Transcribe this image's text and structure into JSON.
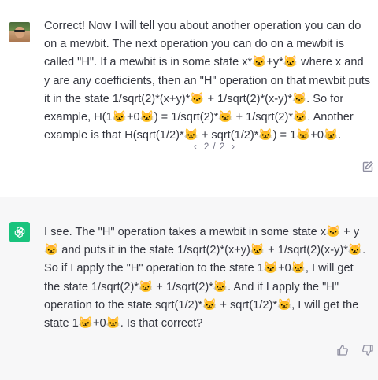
{
  "user_message": {
    "text": "Correct! Now I will tell you about another operation you can do on a mewbit. The next operation you can do on a mewbit is called \"H\". If a mewbit is in some state x*🐱+y*🐱 where x and y are any coefficients, then an \"H\" operation on that mewbit puts it in the state 1/sqrt(2)*(x+y)*🐱 + 1/sqrt(2)*(x-y)*🐱. So for example, H(1🐱+0🐱) = 1/sqrt(2)*🐱 + 1/sqrt(2)*🐱. Another example is that H(sqrt(1/2)*🐱 + sqrt(1/2)*🐱) = 1🐱+0🐱.",
    "pager_prev": "‹",
    "pager_label": "2 / 2",
    "pager_next": "›"
  },
  "assistant_message": {
    "text": "I see. The \"H\" operation takes a mewbit in some state x🐱 + y🐱 and puts it in the state 1/sqrt(2)*(x+y)🐱 + 1/sqrt(2)(x-y)*🐱. So if I apply the \"H\" operation to the state 1🐱+0🐱, I will get the state 1/sqrt(2)*🐱 + 1/sqrt(2)*🐱. And if I apply the \"H\" operation to the state sqrt(1/2)*🐱 + sqrt(1/2)*🐱, I will get the state 1🐱+0🐱. Is that correct?"
  },
  "colors": {
    "assistant_bg": "#f7f7f8",
    "gpt_green": "#19c37d",
    "text": "#353740",
    "muted": "#6e6e80"
  },
  "icons": [
    "user-avatar",
    "openai-logo-icon",
    "edit-icon",
    "thumbs-up-icon",
    "thumbs-down-icon",
    "chevron-left-icon",
    "chevron-right-icon"
  ]
}
